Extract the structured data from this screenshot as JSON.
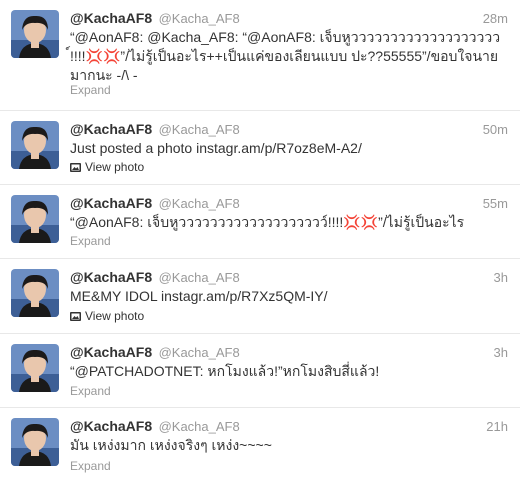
{
  "tweets": [
    {
      "fullname": "@KachaAF8",
      "username": "@Kacha_AF8",
      "time": "28m",
      "text": "“@AonAF8: @Kacha_AF8: “@AonAF8: เจ็บหูววววววววววววววววววว์!!!!💢💢”/ไม่รู้เป็นอะไร++เป็นแค่ของเลียนแบบ ปะ??55555”/ขอบใจนายมากนะ -/\\ -",
      "footer": "Expand"
    },
    {
      "fullname": "@KachaAF8",
      "username": "@Kacha_AF8",
      "time": "50m",
      "text_prefix": "Just posted a photo ",
      "link": "instagr.am/p/R7oz8eM-A2/",
      "footer": "View photo"
    },
    {
      "fullname": "@KachaAF8",
      "username": "@Kacha_AF8",
      "time": "55m",
      "text": "“@AonAF8: เจ็บหูววววววววววววววววววว์!!!!💢💢”/ไม่รู้เป็นอะไร",
      "footer": "Expand"
    },
    {
      "fullname": "@KachaAF8",
      "username": "@Kacha_AF8",
      "time": "3h",
      "text_prefix": "ME&MY IDOL ",
      "link": "instagr.am/p/R7Xz5QM-IY/",
      "footer": "View photo"
    },
    {
      "fullname": "@KachaAF8",
      "username": "@Kacha_AF8",
      "time": "3h",
      "text": "“@PATCHADOTNET: หกโมงแล้ว!”หกโมงสิบสี่แล้ว!",
      "footer": "Expand"
    },
    {
      "fullname": "@KachaAF8",
      "username": "@Kacha_AF8",
      "time": "21h",
      "text": "มัน เหง่งมาก เหง่งจริงๆ เหง่ง~~~~",
      "footer": "Expand"
    }
  ],
  "icons": {
    "avatar": "avatar-image",
    "photo": "photo-icon"
  },
  "colors": {
    "meta": "#999999",
    "text": "#333333",
    "divider": "#e8e8e8",
    "avatar_bg": "#5b7fb8"
  }
}
